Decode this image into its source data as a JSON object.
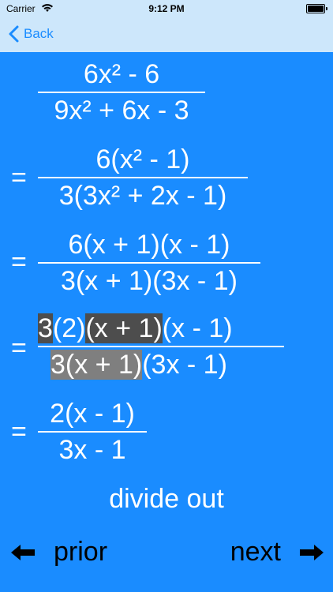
{
  "status": {
    "carrier": "Carrier",
    "time": "9:12 PM"
  },
  "nav": {
    "back_label": "Back"
  },
  "steps": [
    {
      "num": "6x² - 6",
      "den": "9x² + 6x - 3",
      "eq": ""
    },
    {
      "num": "6(x² - 1)",
      "den": "3(3x² + 2x - 1)",
      "eq": "="
    },
    {
      "num": "6(x + 1)(x - 1)",
      "den": "3(x + 1)(3x - 1)",
      "eq": "="
    },
    {
      "num_parts": [
        "3",
        "(2)",
        "(x + 1)",
        "(x - 1)"
      ],
      "den_parts": [
        "3(x + 1)",
        "(3x - 1)"
      ],
      "eq": "="
    },
    {
      "num": "2(x - 1)",
      "den": "3x - 1",
      "eq": "="
    }
  ],
  "caption": "divide out",
  "footer": {
    "prior_label": "prior",
    "next_label": "next"
  },
  "colors": {
    "background": "#1a8cff",
    "bar": "#cde7fb",
    "highlight_dark": "#4d4d4d",
    "highlight_gray": "#7f7f7f"
  }
}
